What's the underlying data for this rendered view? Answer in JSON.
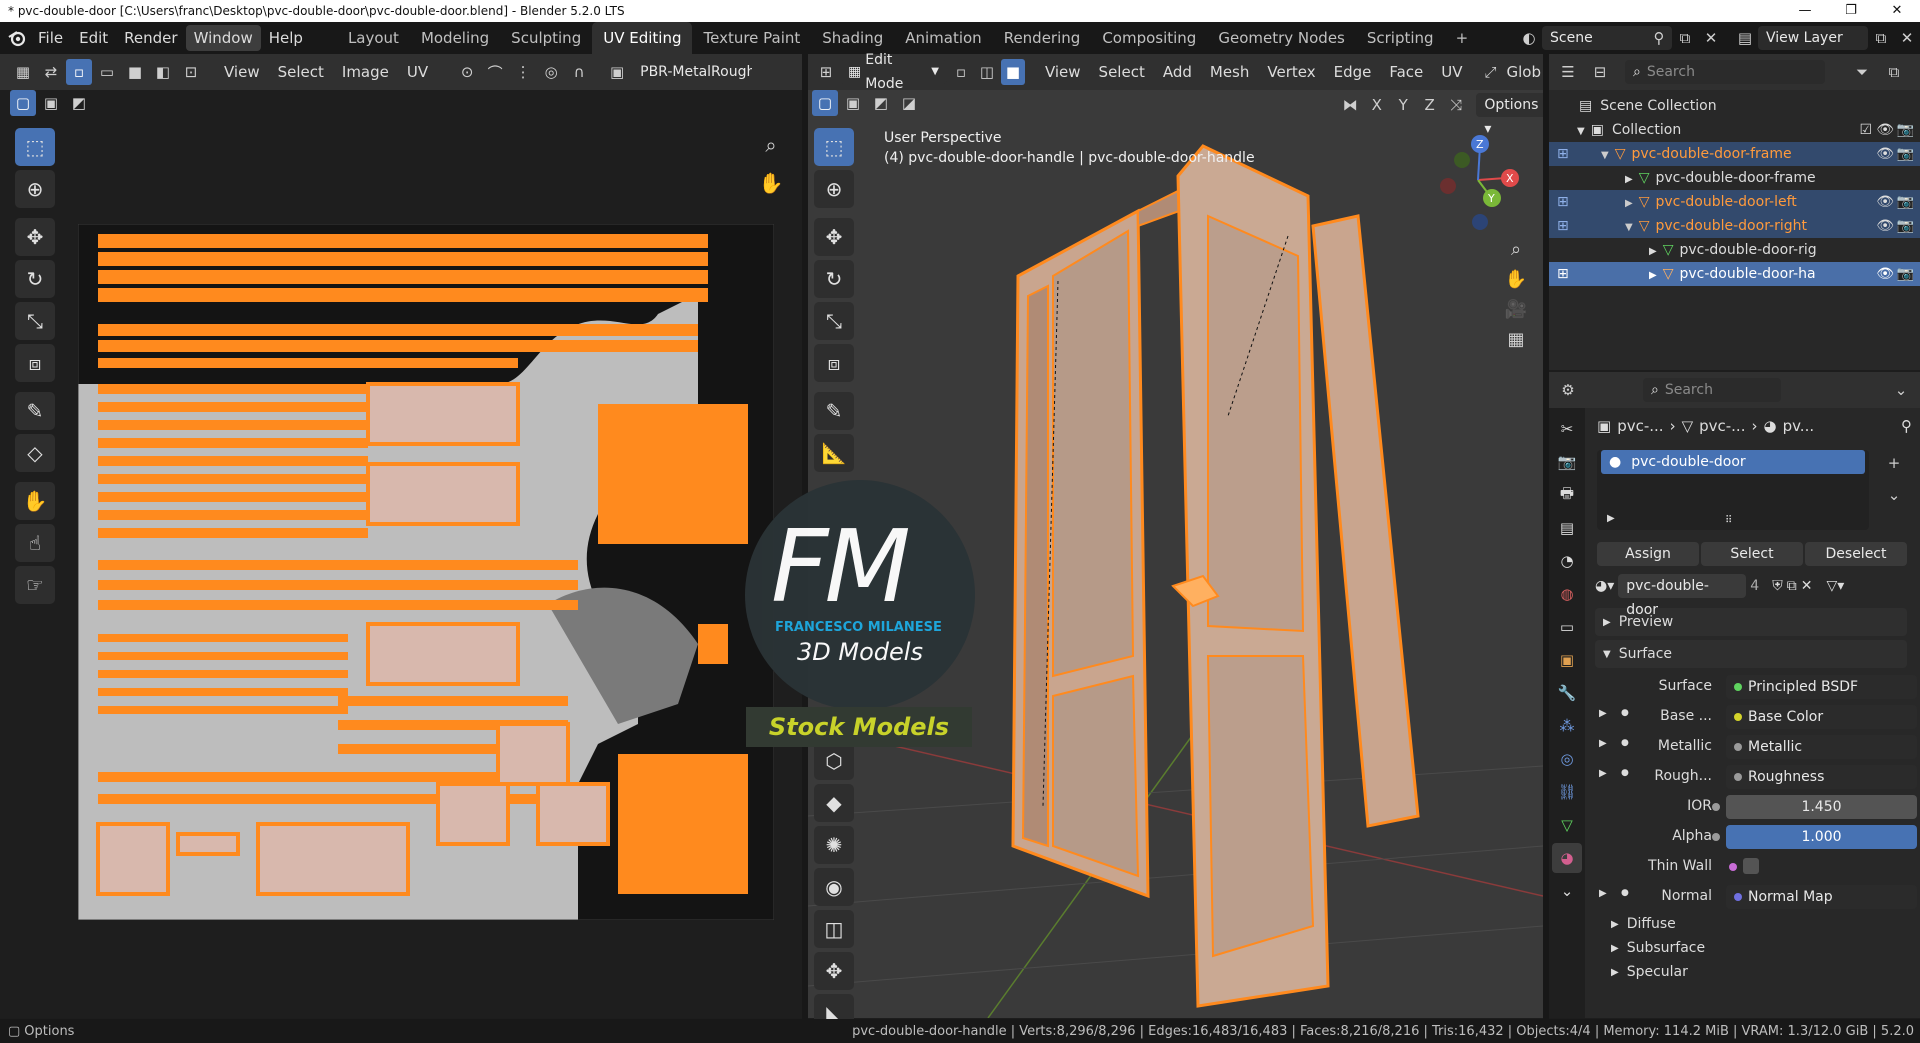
{
  "window": {
    "title": "* pvc-double-door [C:\\Users\\franc\\Desktop\\pvc-double-door\\pvc-double-door.blend] - Blender 5.2.0 LTS",
    "controls": [
      "—",
      "❐",
      "✕"
    ]
  },
  "menu": [
    "File",
    "Edit",
    "Render",
    "Window",
    "Help"
  ],
  "active_menu": "Window",
  "workspaces": [
    "Layout",
    "Modeling",
    "Sculpting",
    "UV Editing",
    "Texture Paint",
    "Shading",
    "Animation",
    "Rendering",
    "Compositing",
    "Geometry Nodes",
    "Scripting",
    "+"
  ],
  "active_workspace": "UV Editing",
  "scene": {
    "name": "Scene",
    "view_layer": "View Layer"
  },
  "uv_editor": {
    "menus": [
      "View",
      "Select",
      "Image",
      "UV"
    ],
    "image_name": "PBR-MetalRough"
  },
  "viewport": {
    "mode": "Edit Mode",
    "menus": [
      "View",
      "Select",
      "Add",
      "Mesh",
      "Vertex",
      "Edge",
      "Face",
      "UV"
    ],
    "orientation": "Glob",
    "axes": [
      "X",
      "Y",
      "Z"
    ],
    "options": "Options",
    "perspective": "User Perspective",
    "object_info": "(4) pvc-double-door-handle | pvc-double-door-handle"
  },
  "watermark": {
    "letters": "FM",
    "name": "FRANCESCO MILANESE",
    "subtitle": "3D Models",
    "stock": "Stock Models"
  },
  "outliner": {
    "search_placeholder": "Search",
    "scene_collection": "Scene Collection",
    "collection": "Collection",
    "items": [
      {
        "label": "pvc-double-door-frame",
        "level": 2,
        "kind": "object"
      },
      {
        "label": "pvc-double-door-frame",
        "level": 3,
        "kind": "mesh"
      },
      {
        "label": "pvc-double-door-left",
        "level": 2,
        "kind": "object"
      },
      {
        "label": "pvc-double-door-right",
        "level": 2,
        "kind": "object"
      },
      {
        "label": "pvc-double-door-rig",
        "level": 3,
        "kind": "mesh"
      },
      {
        "label": "pvc-double-door-ha",
        "level": 3,
        "kind": "object"
      }
    ]
  },
  "properties": {
    "search_placeholder": "Search",
    "breadcrumb": [
      "pvc-...",
      "pvc-...",
      "pv..."
    ],
    "material_slot": "pvc-double-door",
    "buttons": [
      "Assign",
      "Select",
      "Deselect"
    ],
    "material_name": "pvc-double-door",
    "user_count": "4",
    "panels": {
      "preview": "Preview",
      "surface": "Surface"
    },
    "surface_rows": [
      {
        "label": "Surface",
        "value": "Principled BSDF",
        "dot": "#5fd35f"
      },
      {
        "label": "Base ...",
        "value": "Base Color",
        "dot": "#d4d42b"
      },
      {
        "label": "Metallic",
        "value": "Metallic",
        "dot": "#9a9a9a"
      },
      {
        "label": "Rough...",
        "value": "Roughness",
        "dot": "#9a9a9a"
      },
      {
        "label": "IOR",
        "value": "1.450",
        "dot": "#9a9a9a"
      },
      {
        "label": "Alpha",
        "value": "1.000",
        "dot": "#9a9a9a"
      },
      {
        "label": "Thin Wall",
        "value": "",
        "dot": "#c86cd6"
      },
      {
        "label": "Normal",
        "value": "Normal Map",
        "dot": "#7070e0"
      }
    ],
    "subpanels": [
      "Diffuse",
      "Subsurface",
      "Specular"
    ]
  },
  "status": {
    "left": "Options",
    "right": "pvc-double-door-handle | Verts:8,296/8,296 | Edges:16,483/16,483 | Faces:8,216/8,216 | Tris:16,432 | Objects:4/4 | Memory: 114.2 MiB | VRAM: 1.3/12.0 GiB | 5.2.0"
  },
  "colors": {
    "accent": "#4772b3",
    "uv_orange": "#ff8a1e",
    "selected_object": "#ff9a3c",
    "header": "#303030",
    "bg": "#1d1d1d"
  }
}
